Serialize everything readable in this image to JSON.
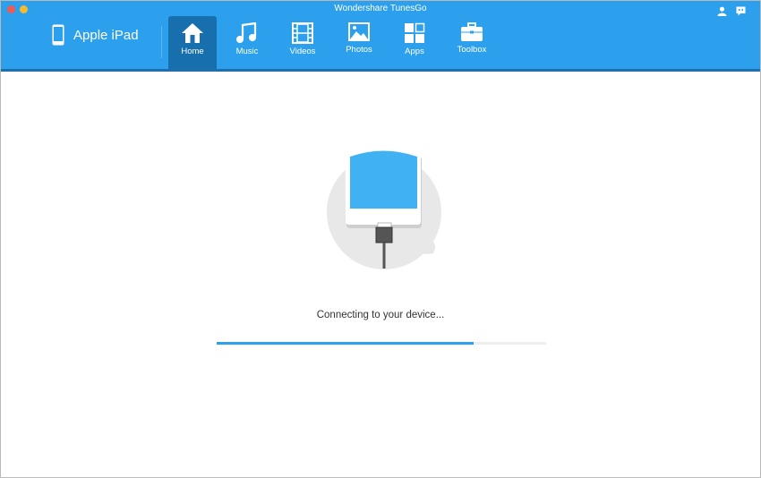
{
  "window": {
    "title": "Wondershare TunesGo"
  },
  "device": {
    "name": "Apple iPad",
    "icon": "ipad-icon"
  },
  "tabs": [
    {
      "label": "Home",
      "icon": "home-icon",
      "active": true
    },
    {
      "label": "Music",
      "icon": "music-icon"
    },
    {
      "label": "Videos",
      "icon": "film-icon"
    },
    {
      "label": "Photos",
      "icon": "photo-icon"
    },
    {
      "label": "Apps",
      "icon": "apps-icon"
    },
    {
      "label": "Toolbox",
      "icon": "toolbox-icon"
    }
  ],
  "status": {
    "message": "Connecting to your device...",
    "progress_percent": 78
  },
  "colors": {
    "accent": "#2ca0ec",
    "active_tab": "#176fad"
  }
}
